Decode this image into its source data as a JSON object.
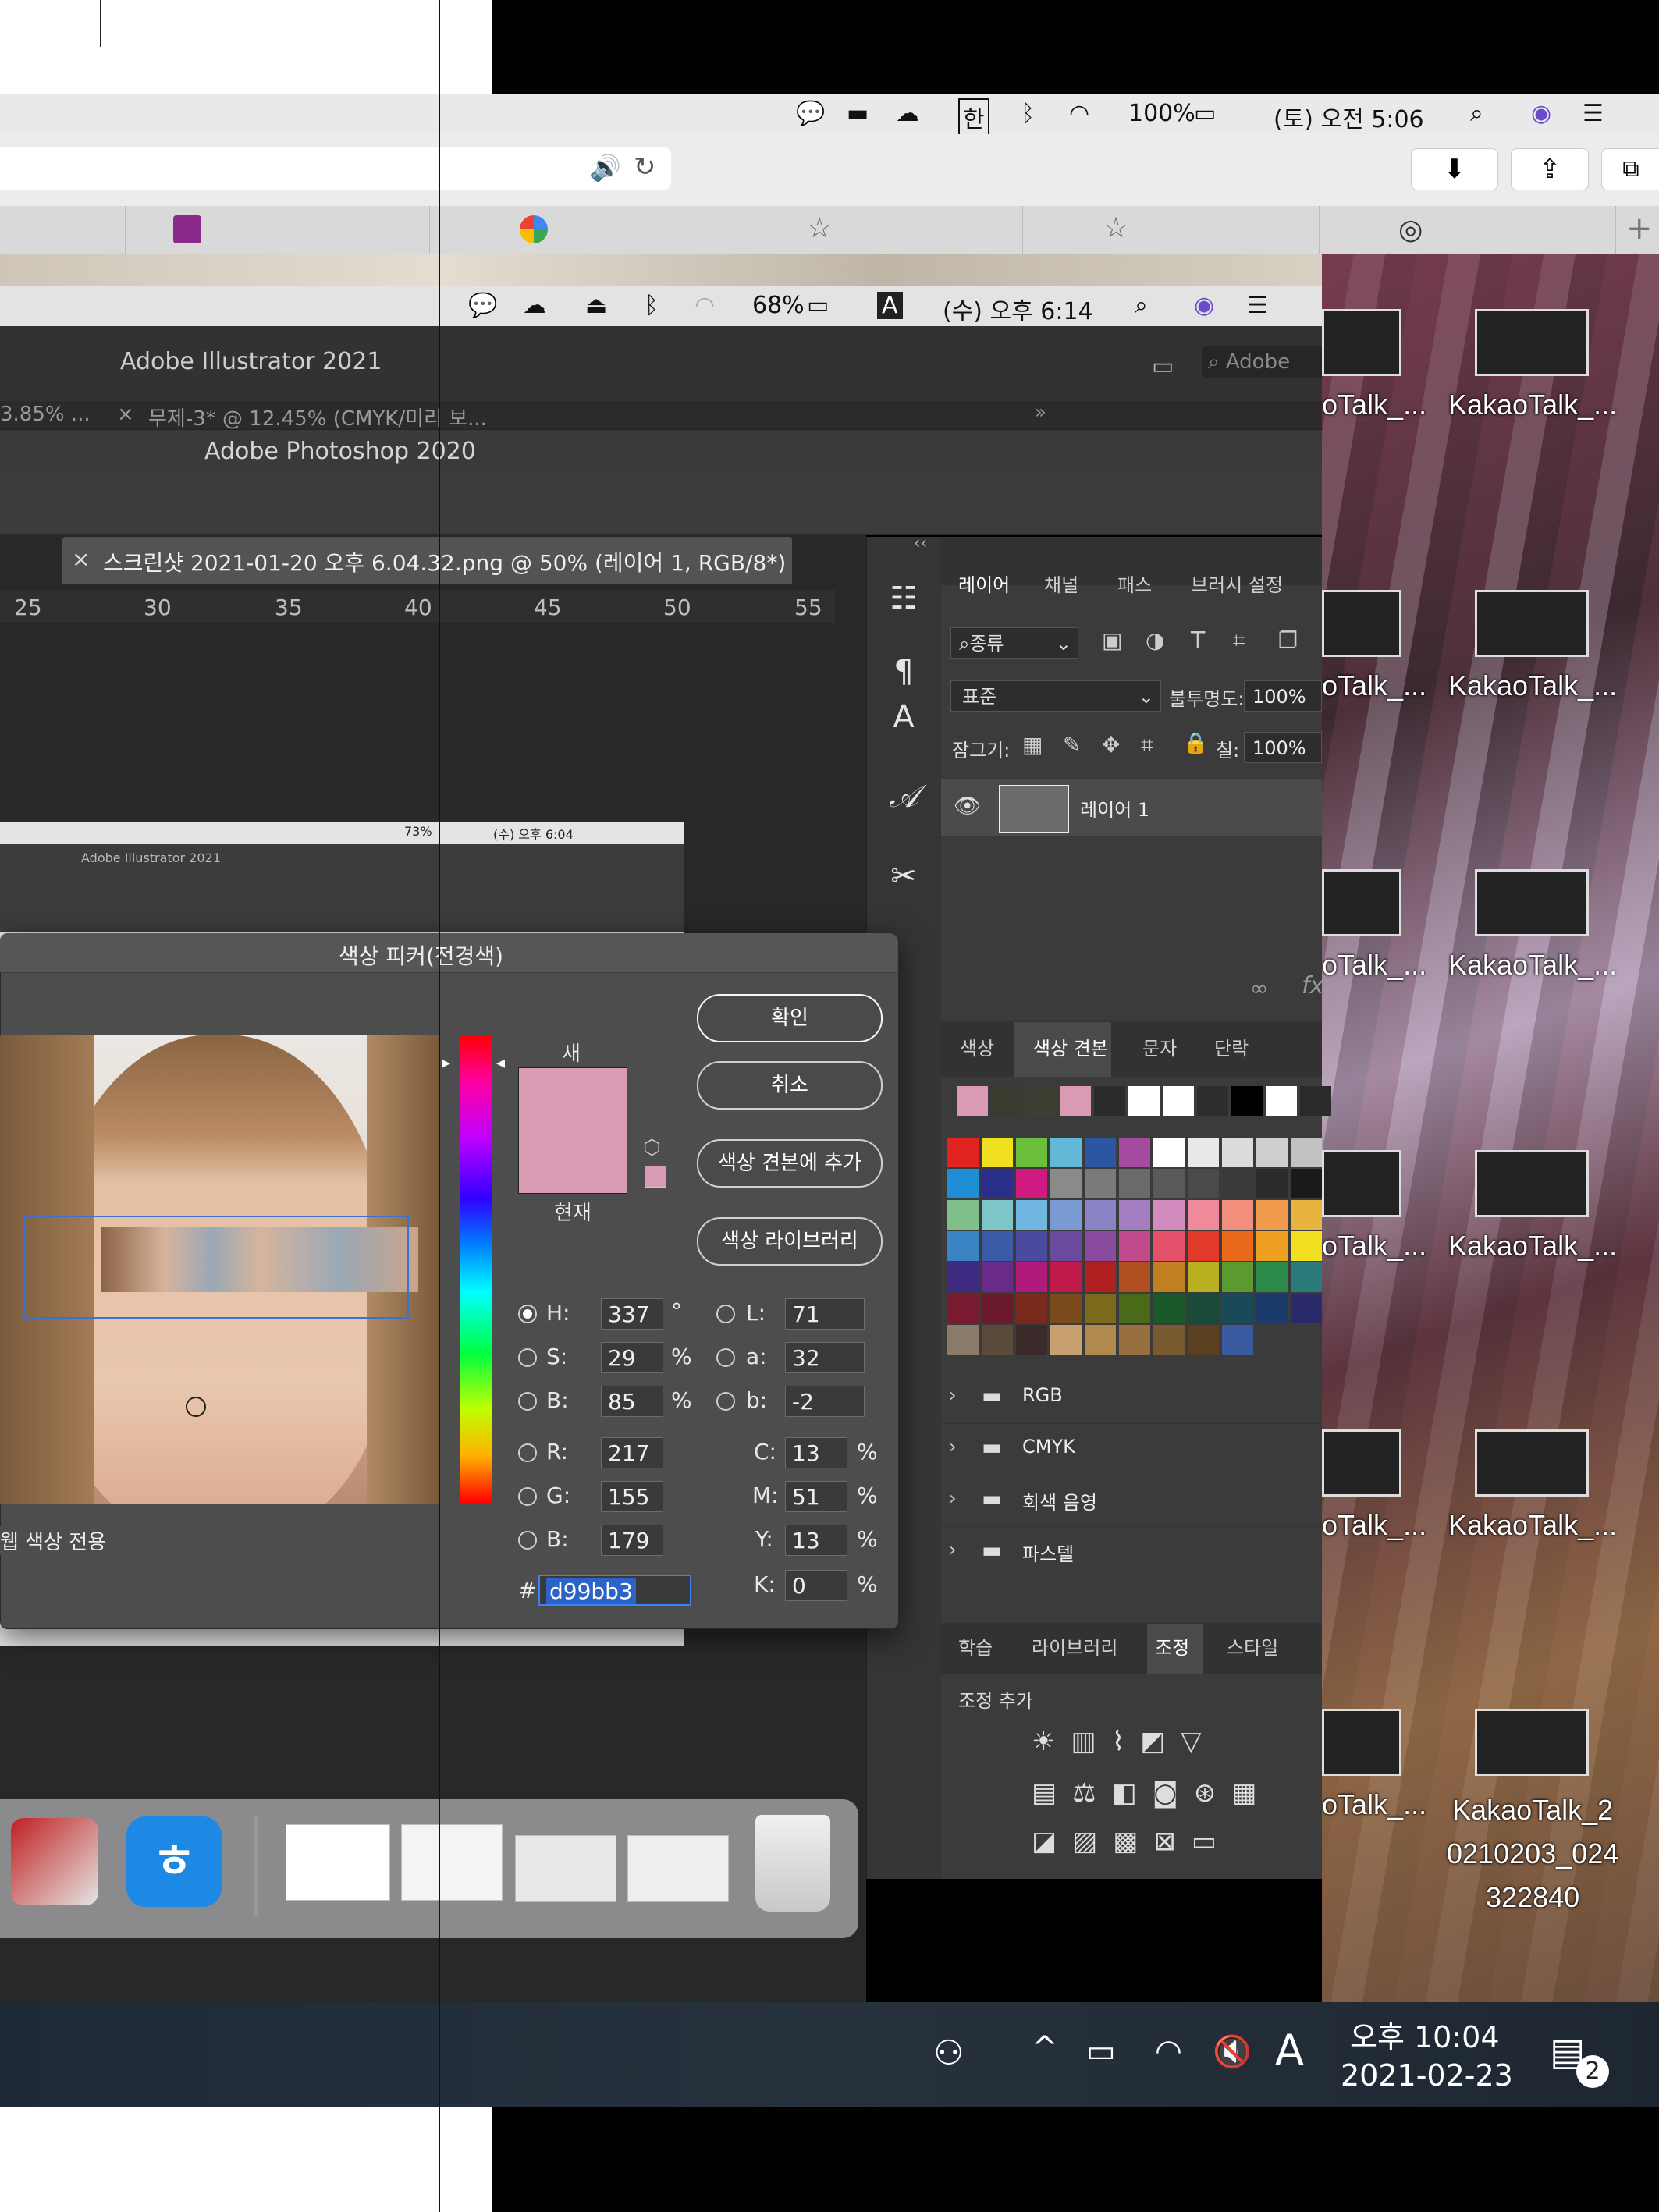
{
  "top_menubar": {
    "battery": "100%",
    "hangul": "한",
    "clock": "(토) 오전 5:06"
  },
  "desktop": {
    "icons": [
      {
        "label": "oTalk_..."
      },
      {
        "label": "KakaoTalk_..."
      },
      {
        "label": "oTalk_..."
      },
      {
        "label": "KakaoTalk_..."
      },
      {
        "label": "oTalk_..."
      },
      {
        "label": "KakaoTalk_..."
      },
      {
        "label": "oTalk_..."
      },
      {
        "label": "KakaoTalk_..."
      },
      {
        "label": "oTalk_..."
      },
      {
        "label": "KakaoTalk_..."
      },
      {
        "label": "oTalk_..."
      },
      {
        "label": "KakaoTalk_2\n0210203_024\n322840"
      }
    ]
  },
  "inner_menubar": {
    "battery": "68%",
    "input": "A",
    "clock": "(수) 오후 6:14"
  },
  "illustrator": {
    "title": "Adobe Illustrator 2021",
    "search_placeholder": "Adobe",
    "tab1": "3.85% ...",
    "tab2": "무제-3* @ 12.45% (CMYK/미리 보..."
  },
  "photoshop": {
    "title": "Adobe Photoshop 2020",
    "document_tab": "스크린샷 2021-01-20 오후 6.04.32.png @ 50% (레이어 1, RGB/8*)",
    "ruler": [
      "25",
      "30",
      "35",
      "40",
      "45",
      "50",
      "55"
    ],
    "inner_menubar_clock": "(수) 오후 6:04",
    "inner_battery": "73%",
    "inner_ai_title": "Adobe Illustrator 2021"
  },
  "layers_panel": {
    "tabs": [
      "레이어",
      "채널",
      "패스",
      "브러시 설정"
    ],
    "kind_filter": "종류",
    "blend_mode": "표준",
    "opacity_label": "불투명도:",
    "opacity": "100%",
    "lock_label": "잠그기:",
    "fill_label": "칠:",
    "fill": "100%",
    "layer_name": "레이어 1"
  },
  "swatches_panel": {
    "tabs": [
      "색상",
      "색상 견본",
      "문자",
      "단락"
    ],
    "groups": [
      "RGB",
      "CMYK",
      "회색 음영",
      "파스텔"
    ]
  },
  "adjust_panel": {
    "tabs": [
      "학습",
      "라이브러리",
      "조정",
      "스타일"
    ],
    "heading": "조정 추가"
  },
  "color_picker": {
    "title": "색상 피커(전경색)",
    "new_label": "새",
    "current_label": "현재",
    "ok": "확인",
    "cancel": "취소",
    "add_swatch": "색상 견본에 추가",
    "library": "색상 라이브러리",
    "web_only": "웹 색상 전용",
    "new_color": "#d99bb3",
    "fields": {
      "H": "337",
      "S": "29",
      "Bv": "85",
      "R": "217",
      "G": "155",
      "Bc": "179",
      "L": "71",
      "a": "32",
      "b": "-2",
      "C": "13",
      "M": "51",
      "Y": "13",
      "K": "0"
    },
    "hex": "d99bb3",
    "labels": {
      "H": "H:",
      "S": "S:",
      "Bv": "B:",
      "R": "R:",
      "G": "G:",
      "Bc": "B:",
      "L": "L:",
      "a": "a:",
      "b": "b:",
      "C": "C:",
      "M": "M:",
      "Y": "Y:",
      "K": "K:",
      "hash": "#"
    },
    "units": {
      "deg": "°",
      "pct": "%"
    }
  },
  "taskbar": {
    "ime": "A",
    "time": "오후 10:04",
    "date": "2021-02-23",
    "notifications": "2"
  }
}
